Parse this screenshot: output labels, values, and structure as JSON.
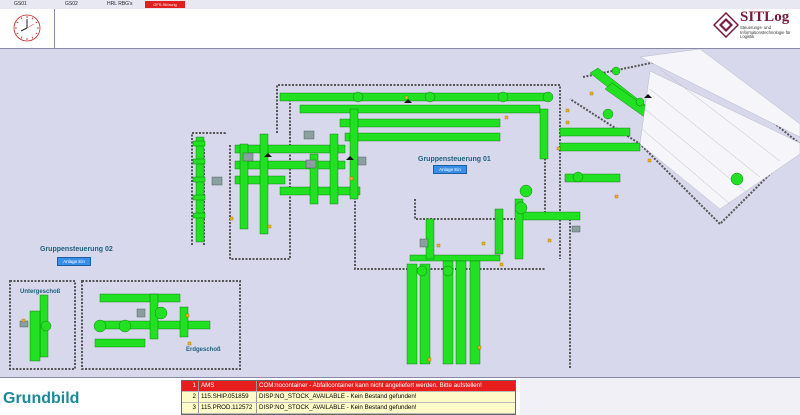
{
  "topbar": {
    "items": [
      {
        "label": "GS01"
      },
      {
        "label": "GS02"
      },
      {
        "label": "HRL RBG's"
      }
    ],
    "alarm_label": "GFS-Störung"
  },
  "header": {
    "logo_name": "SITLog",
    "logo_subtitle": "Steuerungs- und Informationstechnologie für Logistik"
  },
  "plant": {
    "group1": {
      "label": "Gruppensteuerung 01",
      "button": "Anlage Ein"
    },
    "group2": {
      "label": "Gruppensteuerung 02",
      "button": "Anlage Ein"
    },
    "basement_label": "Untergeschoß",
    "ground_label": "Erdgeschoß"
  },
  "footer": {
    "title": "Grundbild",
    "messages": [
      {
        "num": "1",
        "code": "AMS",
        "text": "COM:nocontainer - Abfallcontainer kann nicht angeliefert werden. Bitte aufstellen!",
        "severity": "error"
      },
      {
        "num": "2",
        "code": "115.SHIP.051859",
        "text": "DISP:NO_STOCK_AVAILABLE - Kein Bestand gefunden!",
        "severity": "warn"
      },
      {
        "num": "3",
        "code": "115.PROD.112572",
        "text": "DISP:NO_STOCK_AVAILABLE - Kein Bestand gefunden!",
        "severity": "warn"
      }
    ]
  },
  "colors": {
    "conveyor": "#22e022",
    "alarm": "#e02020",
    "button": "#3a8ee8",
    "title": "#1a8a9a"
  }
}
